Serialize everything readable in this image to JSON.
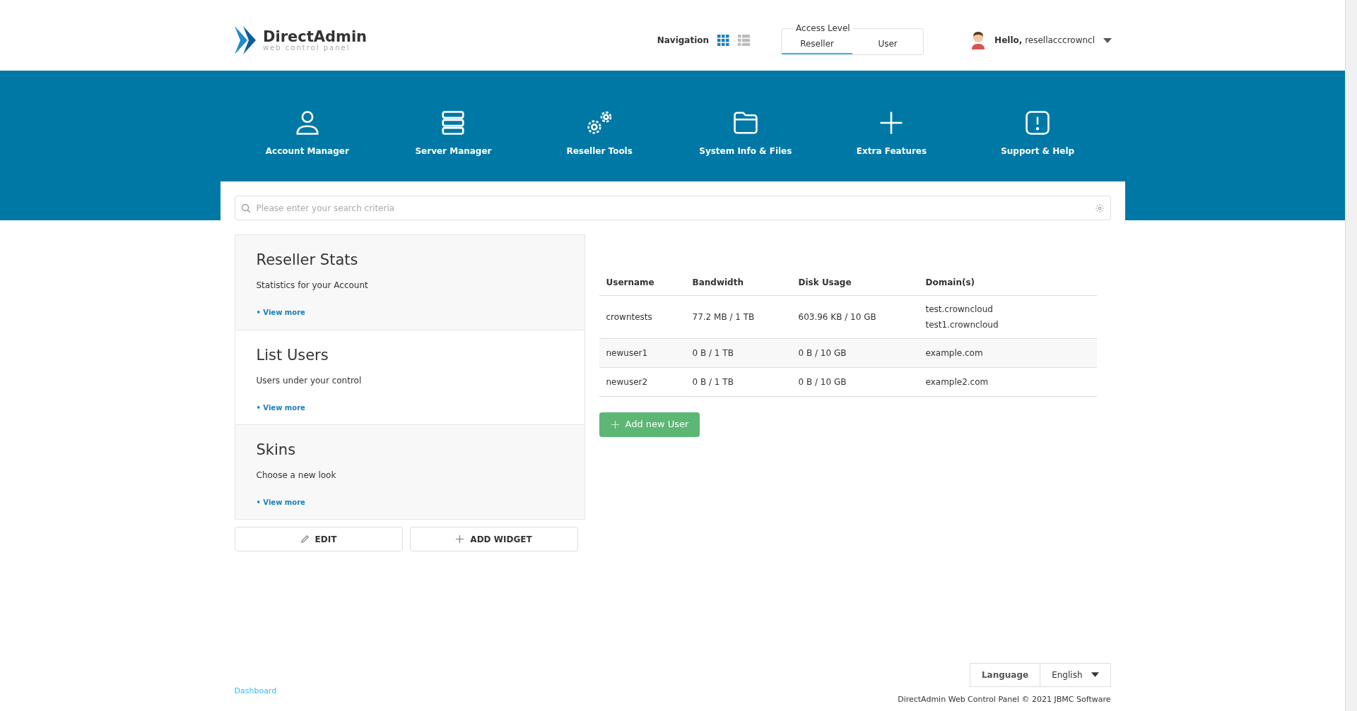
{
  "header": {
    "logo": {
      "title": "DirectAdmin",
      "subtitle": "web control panel"
    },
    "navigation": {
      "label": "Navigation",
      "views": [
        {
          "kind": "grid",
          "selected": true
        },
        {
          "kind": "list",
          "selected": false
        }
      ]
    },
    "access_level": {
      "label": "Access Level",
      "tabs": [
        {
          "label": "Reseller",
          "selected": true
        },
        {
          "label": "User",
          "selected": false
        }
      ]
    },
    "user": {
      "greeting": "Hello,",
      "name": "resellacccrowncl"
    }
  },
  "menu": [
    {
      "kind": "person",
      "label": "Account Manager"
    },
    {
      "kind": "server",
      "label": "Server Manager"
    },
    {
      "kind": "gears",
      "label": "Reseller Tools"
    },
    {
      "kind": "folder",
      "label": "System Info & Files"
    },
    {
      "kind": "plus",
      "label": "Extra Features"
    },
    {
      "kind": "alert",
      "label": "Support & Help"
    }
  ],
  "search": {
    "placeholder": "Please enter your search criteria"
  },
  "widgets": [
    {
      "title": "Reseller Stats",
      "description": "Statistics for your Account",
      "link": "• View more"
    },
    {
      "title": "List Users",
      "description": "Users under your control",
      "link": "• View more"
    },
    {
      "title": "Skins",
      "description": "Choose a new look",
      "link": "• View more"
    }
  ],
  "widget_buttons": [
    {
      "kind": "edit",
      "label": "EDIT"
    },
    {
      "kind": "add",
      "label": "ADD WIDGET"
    }
  ],
  "table": {
    "columns": [
      "Username",
      "Bandwidth",
      "Disk Usage",
      "Domain(s)"
    ],
    "rows": [
      {
        "cells": [
          "crowntests",
          "77.2 MB / 1 TB",
          "603.96 KB / 10 GB"
        ],
        "domains": [
          "test.crowncloud",
          "test1.crowncloud"
        ]
      },
      {
        "cells": [
          "newuser1",
          "0 B / 1 TB",
          "0 B / 10 GB"
        ],
        "domains": [
          "example.com"
        ]
      },
      {
        "cells": [
          "newuser2",
          "0 B / 1 TB",
          "0 B / 10 GB"
        ],
        "domains": [
          "example2.com"
        ]
      }
    ]
  },
  "add_button": "Add new User",
  "footer": {
    "breadcrumb": "Dashboard",
    "language_label": "Language",
    "language": "English",
    "copyright": "DirectAdmin Web Control Panel © 2021 JBMC Software"
  }
}
